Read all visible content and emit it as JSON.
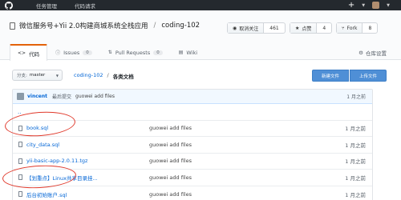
{
  "topbar": {
    "nav": [
      "任务管理",
      "代码请求"
    ],
    "plus_glyph": "+",
    "caret_glyph": "▼"
  },
  "repo": {
    "owner": "微信服务号+Yii 2.0构建商城系统全栈应用",
    "name": "coding-102",
    "separator": "/",
    "unwatch": {
      "label": "取消关注",
      "count": "461"
    },
    "star": {
      "label": "点赞",
      "count": "4"
    },
    "fork": {
      "label": "Fork",
      "count": "8"
    }
  },
  "tabs": [
    {
      "label": "代码",
      "icon": "code-icon",
      "active": true
    },
    {
      "label": "Issues",
      "icon": "issue-icon",
      "badge": "0"
    },
    {
      "label": "Pull Requests",
      "icon": "pull-request-icon",
      "badge": "0"
    },
    {
      "label": "Wiki",
      "icon": "book-icon"
    }
  ],
  "settings_label": "仓库设置",
  "file_nav": {
    "branch_prefix": "分支:",
    "branch": "master",
    "breadcrumb_repo": "coding-102",
    "breadcrumb_slash": "/",
    "breadcrumb_current": "各类文档",
    "new_file": "新建文件",
    "upload_file": "上传文件"
  },
  "latest_commit": {
    "user": "vincent",
    "label": "最后提交",
    "message": "guowei add files",
    "age": "1 月之前"
  },
  "parent_dir_glyph": "..",
  "files": [
    {
      "name": "book.sql",
      "message": "guowei add files",
      "age": "1 月之前"
    },
    {
      "name": "city_data.sql",
      "message": "guowei add files",
      "age": "1 月之前"
    },
    {
      "name": "yii-basic-app-2.0.11.tgz",
      "message": "guowei add files",
      "age": "1 月之前"
    },
    {
      "name": "【划重点】Linux共享目录挂...",
      "message": "guowei add files",
      "age": "1 月之前"
    },
    {
      "name": "后台初始账户.sql",
      "message": "guowei add files",
      "age": "1 月之前"
    }
  ],
  "colors": {
    "topbar": "#24292e",
    "tab_active_accent": "#e36209",
    "primary_button": "#4f8fd6",
    "annotation": "#e0392b",
    "link": "#0366d6"
  }
}
